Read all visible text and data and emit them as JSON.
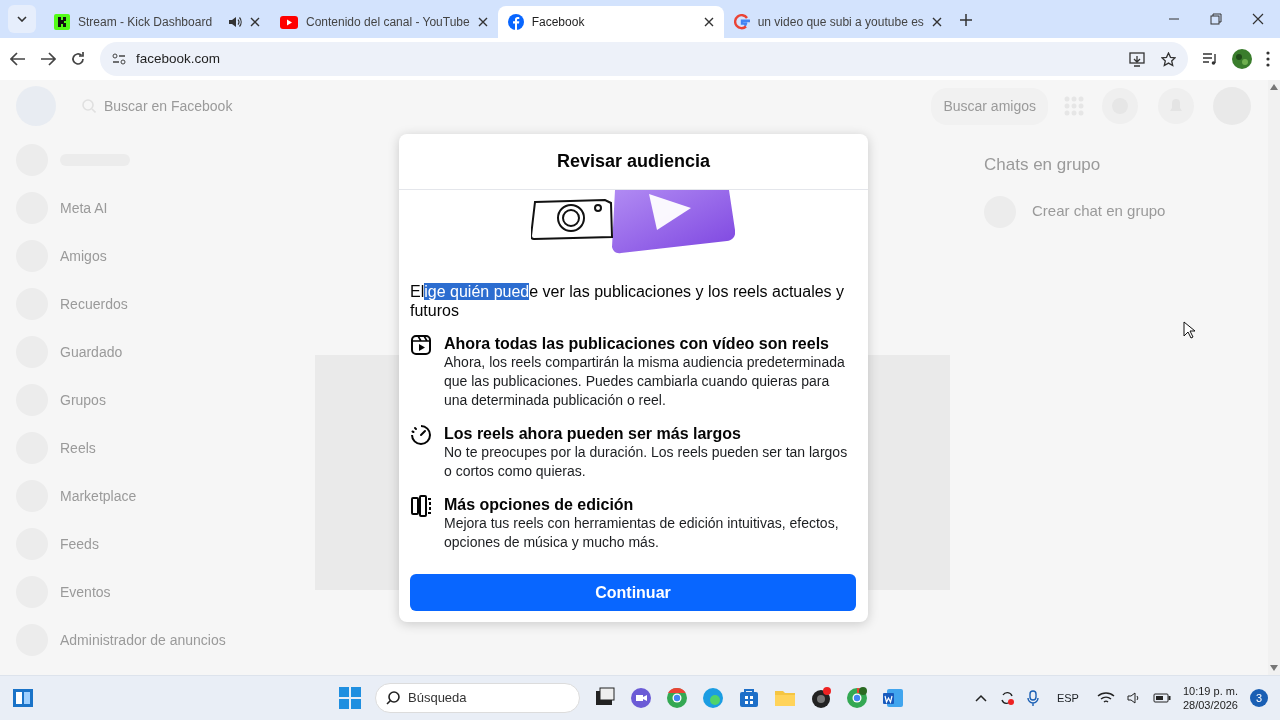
{
  "browser": {
    "tabs": [
      {
        "title": "Stream - Kick Dashboard",
        "kind": "kick",
        "audio": true,
        "selected": false
      },
      {
        "title": "Contenido del canal - YouTube",
        "kind": "youtube",
        "audio": false,
        "selected": false
      },
      {
        "title": "Facebook",
        "kind": "facebook",
        "audio": false,
        "selected": true
      },
      {
        "title": "un video que subi a youtube es",
        "kind": "google",
        "audio": false,
        "selected": false
      }
    ],
    "address": "facebook.com"
  },
  "background_page": {
    "search_placeholder": "Buscar en Facebook",
    "sidebar_items": [
      "Meta AI",
      "Amigos",
      "Recuerdos",
      "Guardado",
      "Grupos",
      "Reels",
      "Marketplace",
      "Feeds",
      "Eventos",
      "Administrador de anuncios"
    ],
    "find_friends": "Buscar amigos",
    "group_chats_title": "Chats en grupo",
    "create_group_chat": "Crear chat en grupo"
  },
  "dialog": {
    "title": "Revisar audiencia",
    "intro": [
      {
        "text": "El",
        "selected": false
      },
      {
        "text": "ige quién pued",
        "selected": true
      },
      {
        "text": "e ver las publicaciones y los reels actuales y futuros",
        "selected": false
      }
    ],
    "features": [
      {
        "kind": "reel",
        "title": "Ahora todas las publicaciones con vídeo son reels",
        "description": "Ahora, los reels compartirán la misma audiencia predeterminada que las publicaciones. Puedes cambiarla cuando quieras para una determinada publicación o reel."
      },
      {
        "kind": "timer",
        "title": "Los reels ahora pueden ser más largos",
        "description": "No te preocupes por la duración. Los reels pueden ser tan largos o cortos como quieras."
      },
      {
        "kind": "edit",
        "title": "Más opciones de edición",
        "description": "Mejora tus reels con herramientas de edición intuitivas, efectos, opciones de música y mucho más."
      }
    ],
    "button": "Continuar"
  },
  "taskbar": {
    "search_placeholder": "Búsqueda",
    "language": "ESP",
    "time": "10:19 p. m.",
    "date": "28/03/2026",
    "notification_count": "3"
  }
}
